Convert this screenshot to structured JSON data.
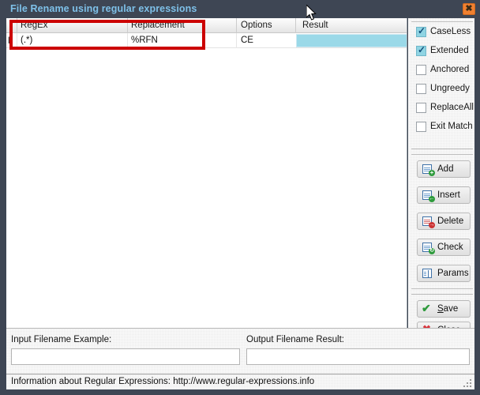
{
  "window": {
    "title": "File Rename using regular expressions",
    "close_label": "✖"
  },
  "grid": {
    "columns": [
      "RegEx",
      "Replacement",
      "Options",
      "Result"
    ],
    "row_indicator": "I",
    "rows": [
      {
        "regex": "(.*)",
        "replacement": "%RFN",
        "options": "CE",
        "result": ""
      }
    ]
  },
  "options_panel": {
    "checkboxes": [
      {
        "label": "CaseLess",
        "checked": true,
        "tick": "✓"
      },
      {
        "label": "Extended",
        "checked": true,
        "tick": "✓"
      },
      {
        "label": "Anchored",
        "checked": false,
        "tick": ""
      },
      {
        "label": "Ungreedy",
        "checked": false,
        "tick": ""
      },
      {
        "label": "ReplaceAll",
        "checked": false,
        "tick": ""
      },
      {
        "label": "Exit Match",
        "checked": false,
        "tick": ""
      }
    ]
  },
  "actions_panel": {
    "buttons": [
      {
        "label": "Add",
        "icon": "add-document-icon",
        "badge": "+",
        "badge_color": "#2e9b3c"
      },
      {
        "label": "Insert",
        "icon": "insert-document-icon",
        "badge": "←",
        "badge_color": "#2e9b3c"
      },
      {
        "label": "Delete",
        "icon": "delete-document-icon",
        "badge": "→",
        "badge_color": "#cc3333"
      },
      {
        "label": "Check",
        "icon": "check-refresh-icon",
        "badge": "↻",
        "badge_color": "#2e9b3c"
      },
      {
        "label": "Params",
        "icon": "params-columns-icon",
        "badge": "",
        "badge_color": "#3f72a8"
      }
    ]
  },
  "commit_panel": {
    "buttons": [
      {
        "label_first": "S",
        "label_rest": "ave",
        "icon": "green-check-icon",
        "glyph": "✔",
        "color": "#2e9b3c"
      },
      {
        "label_first": "C",
        "label_rest": "lose",
        "icon": "red-cross-icon",
        "glyph": "✖",
        "color": "#d9363e"
      }
    ]
  },
  "bottom_panel": {
    "input_label": "Input Filename Example:",
    "input_value": "",
    "input_placeholder": "",
    "output_label": "Output Filename Result:",
    "output_value": "",
    "output_placeholder": ""
  },
  "status_bar": {
    "text": "Information about Regular Expressions: http://www.regular-expressions.info"
  },
  "annotation": {
    "highlight_color": "#cc0000"
  },
  "colors": {
    "titlebar_bg": "#3e4654",
    "title_text": "#7ec0e8",
    "close_button": "#f08030",
    "result_cell": "#9bd9e8",
    "checkbox_checked": "#8fd4e3"
  }
}
